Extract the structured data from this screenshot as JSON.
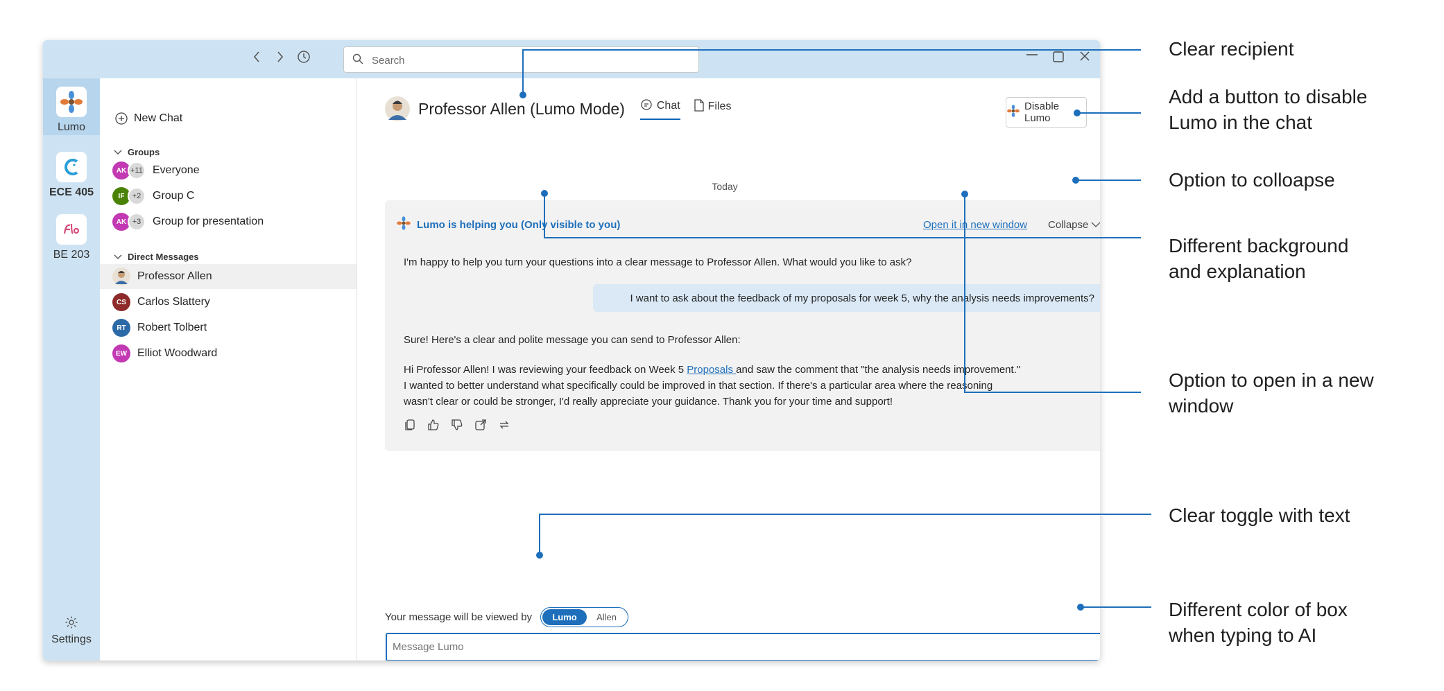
{
  "titlebar": {
    "search_placeholder": "Search"
  },
  "rail": {
    "items": [
      {
        "label": "Lumo"
      },
      {
        "label": "ECE 405"
      },
      {
        "label": "BE 203"
      }
    ],
    "settings_label": "Settings"
  },
  "sidebar": {
    "new_chat": "New Chat",
    "groups_title": "Groups",
    "groups": [
      {
        "initials": "AK",
        "extra": "+11",
        "name": "Everyone",
        "color": "#c239b3"
      },
      {
        "initials": "IF",
        "extra": "+2",
        "name": "Group C",
        "color": "#498205"
      },
      {
        "initials": "AK",
        "extra": "+3",
        "name": "Group for presentation",
        "color": "#c239b3"
      }
    ],
    "dm_title": "Direct Messages",
    "dms": [
      {
        "initials": "",
        "name": "Professor Allen",
        "color": "#8a8a8a"
      },
      {
        "initials": "CS",
        "name": "Carlos Slattery",
        "color": "#8e2a2a"
      },
      {
        "initials": "RT",
        "name": "Robert Tolbert",
        "color": "#2b6aa6"
      },
      {
        "initials": "EW",
        "name": "Elliot Woodward",
        "color": "#c239b3"
      }
    ]
  },
  "chat": {
    "title": "Professor Allen (Lumo Mode)",
    "tab_chat": "Chat",
    "tab_files": "Files",
    "disable_button": "Disable Lumo",
    "date_label": "Today",
    "lumo_banner": "Lumo is helping you (Only visible to you)",
    "open_window": "Open it in new window",
    "collapse": "Collapse",
    "assistant_intro": "I'm happy to help you turn your questions into a clear message to Professor Allen. What would you like to ask?",
    "user_message": "I want to ask about the feedback of my proposals for week 5, why the analysis needs improvements?",
    "assistant_reply_intro": "Sure! Here's a clear and polite message you can send to Professor Allen:",
    "draft_part1": "Hi Professor Allen! I was reviewing your feedback on Week 5 ",
    "draft_link": "Proposals ",
    "draft_part2": "and saw the comment that \"the analysis needs improvement.\"",
    "draft_line2": "I wanted to better understand what specifically could be improved in that section. If there's a particular area where the reasoning",
    "draft_line3": "wasn't clear or could be stronger, I'd really appreciate your guidance. Thank you for your time and support!",
    "viewed_by": "Your message will be viewed by",
    "toggle_on": "Lumo",
    "toggle_off": "Allen",
    "input_placeholder": "Message Lumo"
  },
  "annotations": {
    "a1": "Clear recipient",
    "a2_line1": "Add a button to disable",
    "a2_line2": "Lumo in the chat",
    "a3": "Option to colloapse",
    "a4_line1": "Different background",
    "a4_line2": "and explanation",
    "a5_line1": "Option to open in a new",
    "a5_line2": "window",
    "a6": "Clear toggle with text",
    "a7_line1": "Different color of box",
    "a7_line2": "when typing to AI"
  },
  "colors": {
    "accent": "#1d6fbb",
    "titlebar": "#cde3f3",
    "card_bg": "#f3f2f2",
    "bubble_bg": "#dbe9f6"
  }
}
